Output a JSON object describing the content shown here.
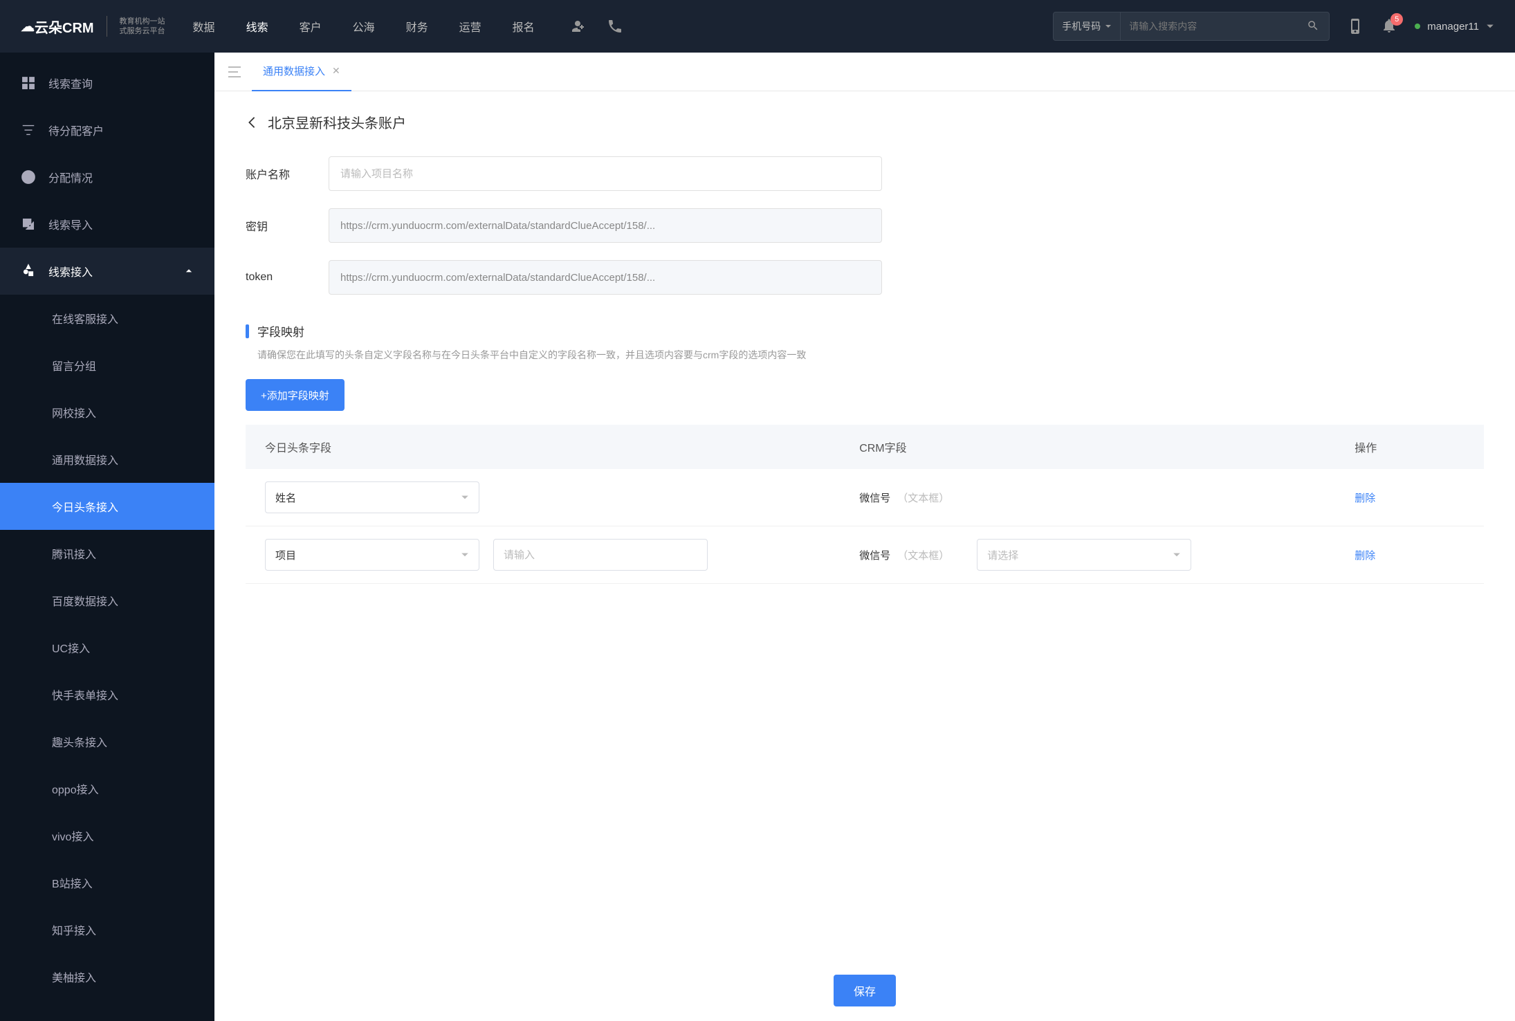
{
  "header": {
    "logo_main": "云朵CRM",
    "logo_sub1": "教育机构一站",
    "logo_sub2": "式服务云平台",
    "nav": [
      "数据",
      "线索",
      "客户",
      "公海",
      "财务",
      "运营",
      "报名"
    ],
    "nav_active": 1,
    "search_type": "手机号码",
    "search_placeholder": "请输入搜索内容",
    "badge": "5",
    "user": "manager11"
  },
  "sidebar": {
    "items": [
      {
        "label": "线索查询"
      },
      {
        "label": "待分配客户"
      },
      {
        "label": "分配情况"
      },
      {
        "label": "线索导入"
      },
      {
        "label": "线索接入",
        "expanded": true,
        "children": [
          "在线客服接入",
          "留言分组",
          "网校接入",
          "通用数据接入",
          "今日头条接入",
          "腾讯接入",
          "百度数据接入",
          "UC接入",
          "快手表单接入",
          "趣头条接入",
          "oppo接入",
          "vivo接入",
          "B站接入",
          "知乎接入",
          "美柚接入"
        ],
        "active_child": 4
      }
    ]
  },
  "tabs": {
    "items": [
      {
        "label": "通用数据接入"
      }
    ],
    "active": 0
  },
  "page": {
    "title": "北京昱新科技头条账户",
    "form": {
      "account_label": "账户名称",
      "account_placeholder": "请输入项目名称",
      "secret_label": "密钥",
      "secret_value": "https://crm.yunduocrm.com/externalData/standardClueAccept/158/...",
      "token_label": "token",
      "token_value": "https://crm.yunduocrm.com/externalData/standardClueAccept/158/..."
    },
    "mapping": {
      "title": "字段映射",
      "desc": "请确保您在此填写的头条自定义字段名称与在今日头条平台中自定义的字段名称一致，并且选项内容要与crm字段的选项内容一致",
      "add_label": "+添加字段映射",
      "cols": [
        "今日头条字段",
        "CRM字段",
        "操作"
      ],
      "rows": [
        {
          "tt_field": "姓名",
          "tt_extra": null,
          "crm_name": "微信号",
          "crm_type": "（文本框）",
          "crm_select": null,
          "action": "删除"
        },
        {
          "tt_field": "项目",
          "tt_extra_placeholder": "请输入",
          "crm_name": "微信号",
          "crm_type": "（文本框）",
          "crm_select_placeholder": "请选择",
          "action": "删除"
        }
      ]
    },
    "save": "保存"
  }
}
